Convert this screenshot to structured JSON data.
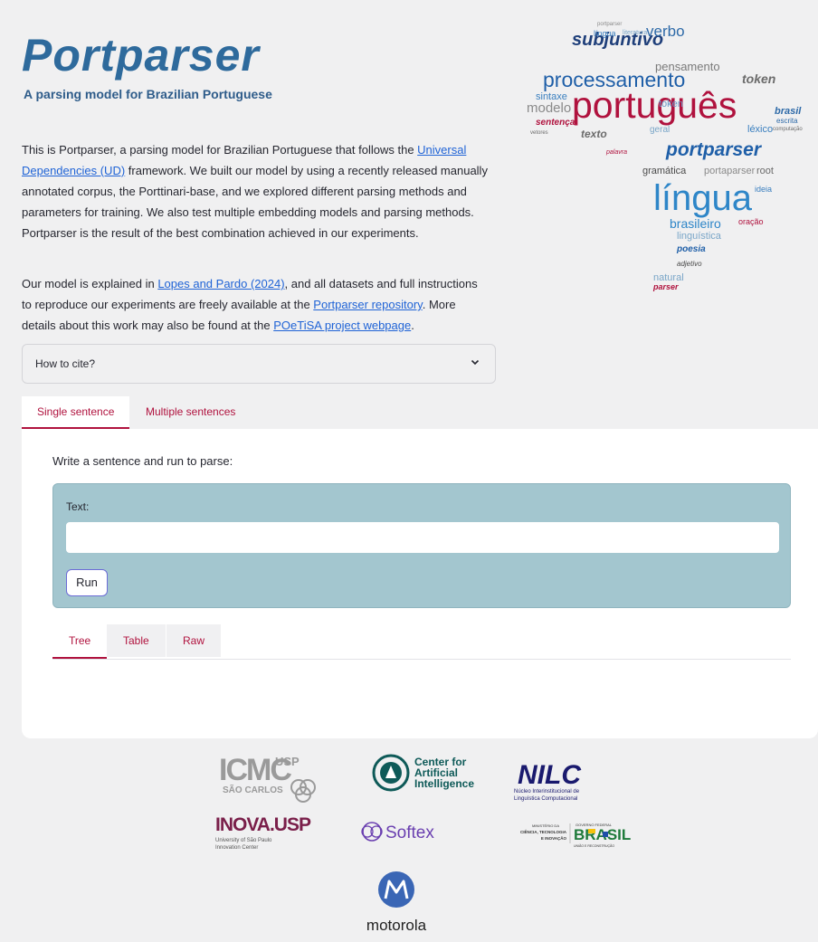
{
  "header": {
    "title": "Portparser",
    "subtitle": "A parsing model for Brazilian Portuguese"
  },
  "intro": {
    "p1_a": "This is Portparser, a parsing model for Brazilian Portuguese that follows the ",
    "p1_link": "Universal Dependencies (UD)",
    "p1_b": " framework. We built our model by using a recently released manually annotated corpus, the Porttinari-base, and we explored different parsing methods and parameters for training. We also test multiple embedding models and parsing methods. Portparser is the result of the best combination achieved in our experiments.",
    "p2_a": "Our model is explained in ",
    "p2_link1": "Lopes and Pardo (2024)",
    "p2_b": ", and all datasets and full instructions to reproduce our experiments are freely available at the ",
    "p2_link2": "Portparser repository",
    "p2_c": ". More details about this work may also be found at the ",
    "p2_link3": "POeTiSA project webpage",
    "p2_d": "."
  },
  "cite": {
    "label": "How to cite?"
  },
  "main_tabs": [
    {
      "label": "Single sentence"
    },
    {
      "label": "Multiple sentences"
    }
  ],
  "single": {
    "prompt": "Write a sentence and run to parse:",
    "text_label": "Text:",
    "text_value": "",
    "run_label": "Run"
  },
  "output_tabs": [
    {
      "label": "Tree"
    },
    {
      "label": "Table"
    },
    {
      "label": "Raw"
    }
  ],
  "wordcloud": {
    "words": [
      "portparser",
      "subjuntivo",
      "língua",
      "literatura",
      "verbo",
      "pensamento",
      "processamento",
      "token",
      "modelo",
      "português",
      "sintaxe",
      "sentença",
      "brasil",
      "texto",
      "léxico",
      "geral",
      "palavra",
      "portparser",
      "gramática",
      "portaparser",
      "root",
      "língua",
      "ideia",
      "brasileiro",
      "oração",
      "linguística",
      "poesia",
      "adjetivo",
      "natural",
      "parser",
      "escrita",
      "computação",
      "token",
      "vetores"
    ]
  },
  "logos": {
    "icmc": "ICMC",
    "icmc_sub": "SÃO CARLOS",
    "usp": "USP",
    "cai_1": "Center for",
    "cai_2": "Artificial",
    "cai_3": "Intelligence",
    "nilc": "NILC",
    "nilc_sub_1": "Núcleo Interinstitucional de",
    "nilc_sub_2": "Linguística Computacional",
    "inova": "INOVA.USP",
    "inova_sub_1": "University of São Paulo",
    "inova_sub_2": "Innovation Center",
    "softex": "Softex",
    "mcti_1": "MINISTÉRIO DA",
    "mcti_2": "CIÊNCIA, TECNOLOGIA",
    "mcti_3": "E INOVAÇÃO",
    "gov_1": "GOVERNO FEDERAL",
    "gov_2": "BRASIL",
    "gov_3": "UNIÃO E RECONSTRUÇÃO",
    "motorola": "motorola"
  },
  "colors": {
    "accent": "#b0123e",
    "title": "#2e6a9c",
    "form_bg": "#a3c6cf"
  }
}
